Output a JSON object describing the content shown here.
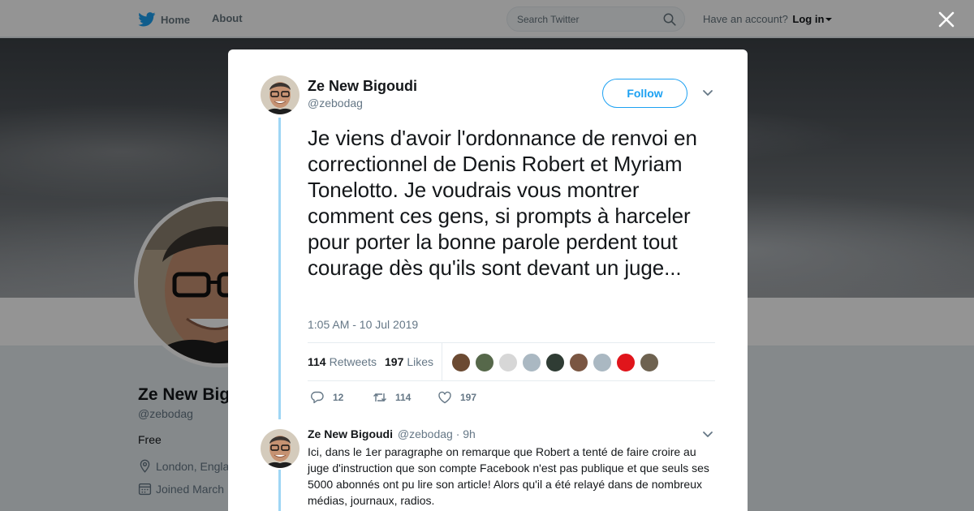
{
  "header": {
    "home_label": "Home",
    "about_label": "About",
    "search_placeholder": "Search Twitter",
    "account_prompt": "Have an account?",
    "login_label": "Log in"
  },
  "profile": {
    "name": "Ze New Big",
    "handle": "@zebodag",
    "bio": "Free",
    "location": "London, Engla",
    "joined": "Joined March"
  },
  "tweet": {
    "author_name": "Ze New Bigoudi",
    "author_handle": "@zebodag",
    "follow_label": "Follow",
    "text": "Je viens d'avoir l'ordonnance de renvoi en correctionnel de Denis Robert et Myriam Tonelotto. Je voudrais vous montrer comment ces gens, si prompts à harceler pour porter la bonne parole perdent tout courage dès qu'ils sont devant un juge...",
    "timestamp": "1:05 AM - 10 Jul 2019",
    "retweets_count": "114",
    "retweets_label": "Retweets",
    "likes_count": "197",
    "likes_label": "Likes",
    "reply_count": "12",
    "retweet_action_count": "114",
    "like_action_count": "197",
    "liker_colors": [
      "#6b4a32",
      "#56684a",
      "#d7d7d7",
      "#aab8c2",
      "#2f3c34",
      "#7a5642",
      "#aab8c2",
      "#e0151b",
      "#6e6250"
    ]
  },
  "reply": {
    "author_name": "Ze New Bigoudi",
    "author_handle": "@zebodag",
    "age": "· 9h",
    "text": "Ici, dans le 1er paragraphe on remarque que Robert a tenté de faire croire au juge d'instruction que son compte Facebook n'est pas publique et que seuls ses 5000 abonnés ont pu lire son article! Alors qu'il a été relayé dans de nombreux médias, journaux, radios."
  },
  "colors": {
    "accent": "#1da1f2",
    "thread_line": "#9fd6f5",
    "muted_text": "#657786"
  }
}
